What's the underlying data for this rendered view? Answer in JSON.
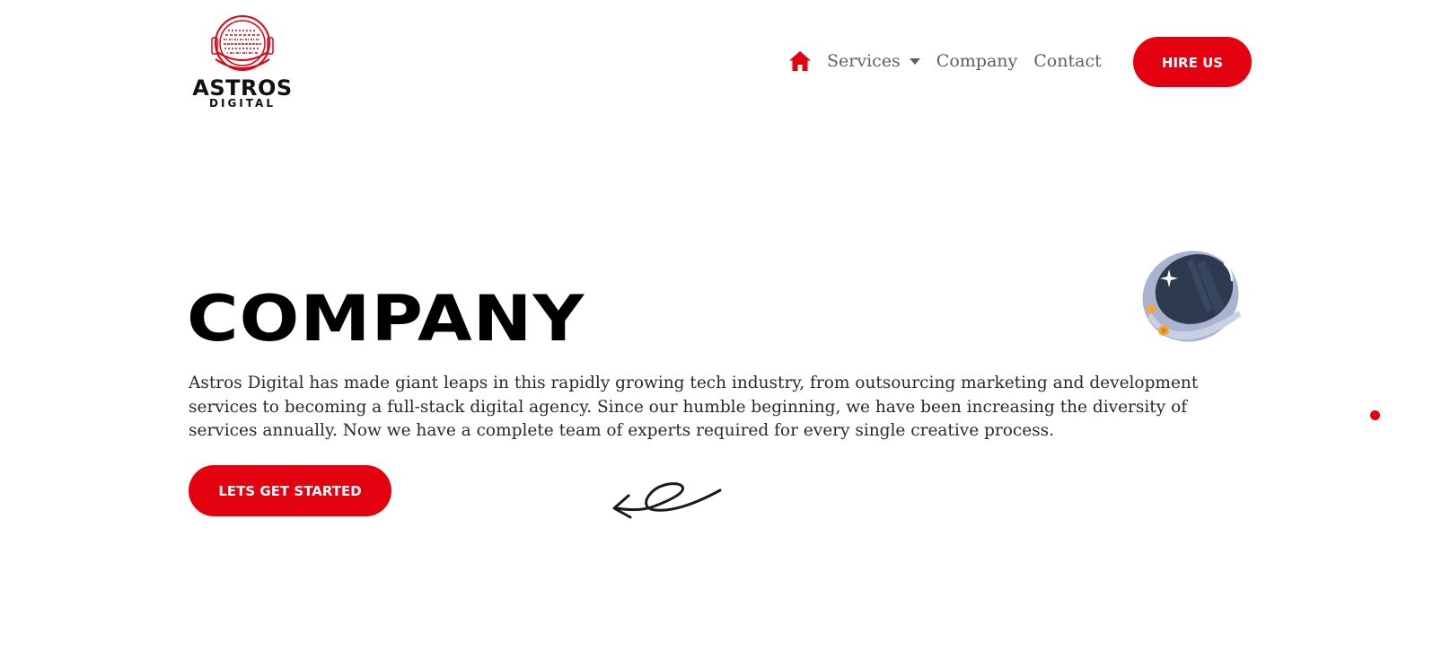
{
  "brand": {
    "name": "ASTROS",
    "subname": "DIGITAL",
    "logo_icon": "astronaut-helmet-binary-icon",
    "color": "#e3000f"
  },
  "nav": {
    "home_icon": "home-icon",
    "items": [
      {
        "label": "Services",
        "has_dropdown": true
      },
      {
        "label": "Company",
        "has_dropdown": false
      },
      {
        "label": "Contact",
        "has_dropdown": false
      }
    ],
    "cta_label": "HIRE US"
  },
  "hero": {
    "title": "COMPANY",
    "description": "Astros Digital has made giant leaps in this rapidly growing tech industry, from outsourcing marketing and development services to becoming a full-stack digital agency. Since our humble beginning, we have been increasing the diversity of services annually. Now we have a complete team of experts required for every single creative process.",
    "cta_label": "LETS GET STARTED",
    "decorations": [
      "hand-drawn-arrow-icon",
      "astronaut-helmet-icon"
    ]
  },
  "colors": {
    "accent": "#e3000f",
    "nav_text": "#5f5f5f",
    "title": "#000000",
    "body_text": "#2a2a2a"
  }
}
